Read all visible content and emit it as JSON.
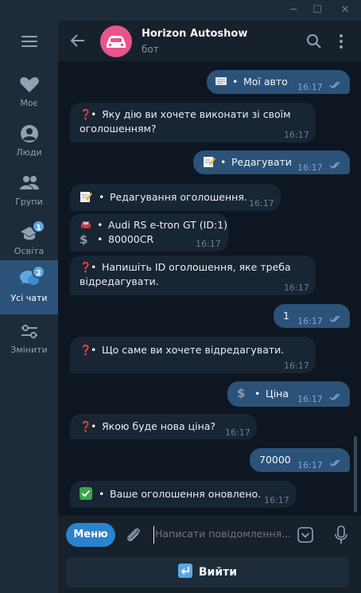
{
  "window": {
    "controls": {
      "min": "─",
      "max": "☐",
      "close": "✕"
    }
  },
  "sidebar": {
    "items": [
      {
        "label": "Моє",
        "icon": "heart-icon"
      },
      {
        "label": "Люди",
        "icon": "person-icon"
      },
      {
        "label": "Групи",
        "icon": "people-icon"
      },
      {
        "label": "Освіта",
        "icon": "graduation-cap-icon",
        "badge": "1"
      },
      {
        "label": "Усі чати",
        "icon": "chats-icon",
        "badge": "2",
        "active": true
      },
      {
        "label": "Змінити",
        "icon": "sliders-icon"
      }
    ]
  },
  "header": {
    "title": "Horizon Autoshow",
    "subtitle": "бот"
  },
  "messages": [
    {
      "dir": "out",
      "emoji": "📃",
      "text": "Мої авто",
      "time": "16:17"
    },
    {
      "dir": "in",
      "emoji": "❓",
      "lines": [
        "Яку дію ви хочете виконати зі своїм",
        "оголошенням?"
      ],
      "time": "16:17"
    },
    {
      "dir": "out",
      "emoji": "📝",
      "text": "Редагувати",
      "time": "16:17"
    },
    {
      "dir": "in",
      "emoji": "📝",
      "text": "Редагування оголошення.",
      "time": "16:17"
    },
    {
      "dir": "in",
      "car_line": "Audi RS e-tron GT (ID:1)",
      "price_line": "80000CR",
      "time": "16:17"
    },
    {
      "dir": "in",
      "emoji": "❓",
      "lines": [
        "Напишіть ID оголошення, яке треба",
        "відредагувати."
      ],
      "time": "16:17"
    },
    {
      "dir": "out",
      "text": "1",
      "time": "16:17"
    },
    {
      "dir": "in",
      "emoji": "❓",
      "text": "Що саме ви хочете відредагувати.",
      "time": "16:17"
    },
    {
      "dir": "out",
      "emoji": "💲",
      "text": "Ціна",
      "time": "16:17"
    },
    {
      "dir": "in",
      "emoji": "❓",
      "text": "Якою буде нова ціна?",
      "time": "16:17"
    },
    {
      "dir": "out",
      "text": "70000",
      "time": "16:17"
    },
    {
      "dir": "in",
      "emoji": "✅",
      "text": "Ваше оголошення оновлено.",
      "time": "16:17"
    }
  ],
  "bullet": "•",
  "composer": {
    "menu_label": "Меню",
    "placeholder": "Написати повідомлення..."
  },
  "keyboard": {
    "exit_label": "Вийти"
  },
  "colors": {
    "accent": "#2b83cc",
    "outgoing_bubble": "#2b5278",
    "incoming_bubble": "#182533",
    "badge": "#5ea7e3",
    "avatar": "#e8558c"
  }
}
